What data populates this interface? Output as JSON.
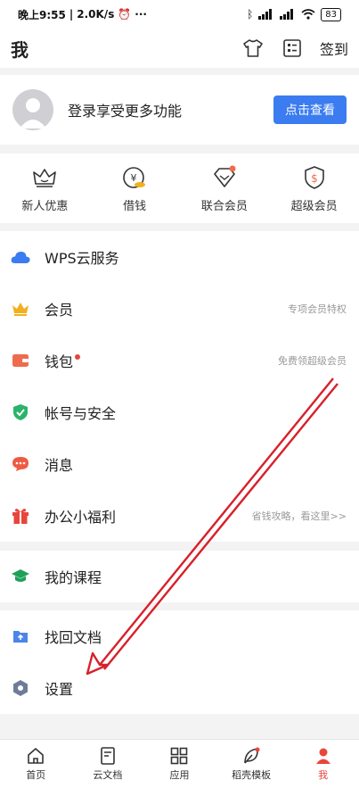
{
  "status_bar": {
    "time": "晚上9:55",
    "speed": "2.0K/s",
    "battery": "83"
  },
  "header": {
    "title": "我",
    "checkin_label": "签到"
  },
  "login": {
    "text": "登录享受更多功能",
    "button_label": "点击查看"
  },
  "quick_items": [
    {
      "label": "新人优惠",
      "icon": "crown-outline-icon"
    },
    {
      "label": "借钱",
      "icon": "coin-icon"
    },
    {
      "label": "联合会员",
      "icon": "diamond-plus-icon"
    },
    {
      "label": "超级会员",
      "icon": "shield-dollar-icon"
    }
  ],
  "menu_group_1": [
    {
      "label": "WPS云服务",
      "hint": "",
      "icon": "cloud-icon",
      "color": "#3b7cf0"
    },
    {
      "label": "会员",
      "hint": "专项会员特权",
      "icon": "crown-icon",
      "color": "#f2b01e"
    },
    {
      "label": "钱包",
      "hint": "免费领超级会员",
      "icon": "wallet-icon",
      "color": "#ef6b4d"
    },
    {
      "label": "帐号与安全",
      "hint": "",
      "icon": "shield-check-icon",
      "color": "#2bb36a"
    },
    {
      "label": "消息",
      "hint": "",
      "icon": "chat-icon",
      "color": "#ef5a43"
    },
    {
      "label": "办公小福利",
      "hint": "省钱攻略，看这里>>",
      "icon": "gift-icon",
      "color": "#e8453c"
    }
  ],
  "menu_group_2": [
    {
      "label": "我的课程",
      "hint": "",
      "icon": "graduation-cap-icon",
      "color": "#1fa05a"
    }
  ],
  "menu_group_3": [
    {
      "label": "找回文档",
      "hint": "",
      "icon": "folder-recover-icon",
      "color": "#4a86e8"
    },
    {
      "label": "设置",
      "hint": "",
      "icon": "settings-hex-icon",
      "color": "#6f7c99"
    }
  ],
  "tabs": [
    {
      "label": "首页",
      "icon": "home-icon"
    },
    {
      "label": "云文档",
      "icon": "document-icon"
    },
    {
      "label": "应用",
      "icon": "apps-grid-icon"
    },
    {
      "label": "稻壳模板",
      "icon": "leaf-icon"
    },
    {
      "label": "我",
      "icon": "user-icon"
    }
  ],
  "colors": {
    "accent": "#3b7cf0",
    "active_tab": "#e8453c",
    "annotation_arrow": "#d8202a"
  }
}
